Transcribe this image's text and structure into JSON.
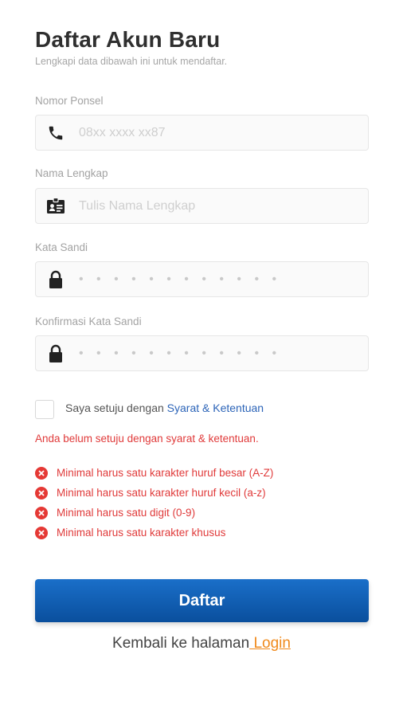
{
  "header": {
    "title": "Daftar Akun Baru",
    "subtitle": "Lengkapi data dibawah ini untuk mendaftar."
  },
  "fields": {
    "phone": {
      "label": "Nomor Ponsel",
      "placeholder": "08xx xxxx xx87",
      "icon": "phone-icon"
    },
    "name": {
      "label": "Nama Lengkap",
      "placeholder": "Tulis Nama Lengkap",
      "icon": "id-card-icon"
    },
    "password": {
      "label": "Kata Sandi",
      "placeholder": "• • • • • • • • • • • •",
      "icon": "lock-icon"
    },
    "confirm_password": {
      "label": "Konfirmasi Kata Sandi",
      "placeholder": "• • • • • • • • • • • •",
      "icon": "lock-icon"
    }
  },
  "agreement": {
    "checked": false,
    "text": "Saya setuju dengan ",
    "link": "Syarat & Ketentuan"
  },
  "errors": {
    "agreement": "Anda belum setuju dengan syarat & ketentuan.",
    "password_rules": [
      "Minimal harus satu karakter huruf besar (A-Z)",
      "Minimal harus satu karakter huruf kecil (a-z)",
      "Minimal harus satu digit (0-9)",
      "Minimal harus satu karakter khusus"
    ]
  },
  "actions": {
    "submit_label": "Daftar",
    "back_text": "Kembali ke halaman",
    "login_link": " Login"
  },
  "colors": {
    "primary": "#0a5bb0",
    "error": "#e03a3a",
    "link": "#2c64b8",
    "login_link": "#f08a1c"
  }
}
